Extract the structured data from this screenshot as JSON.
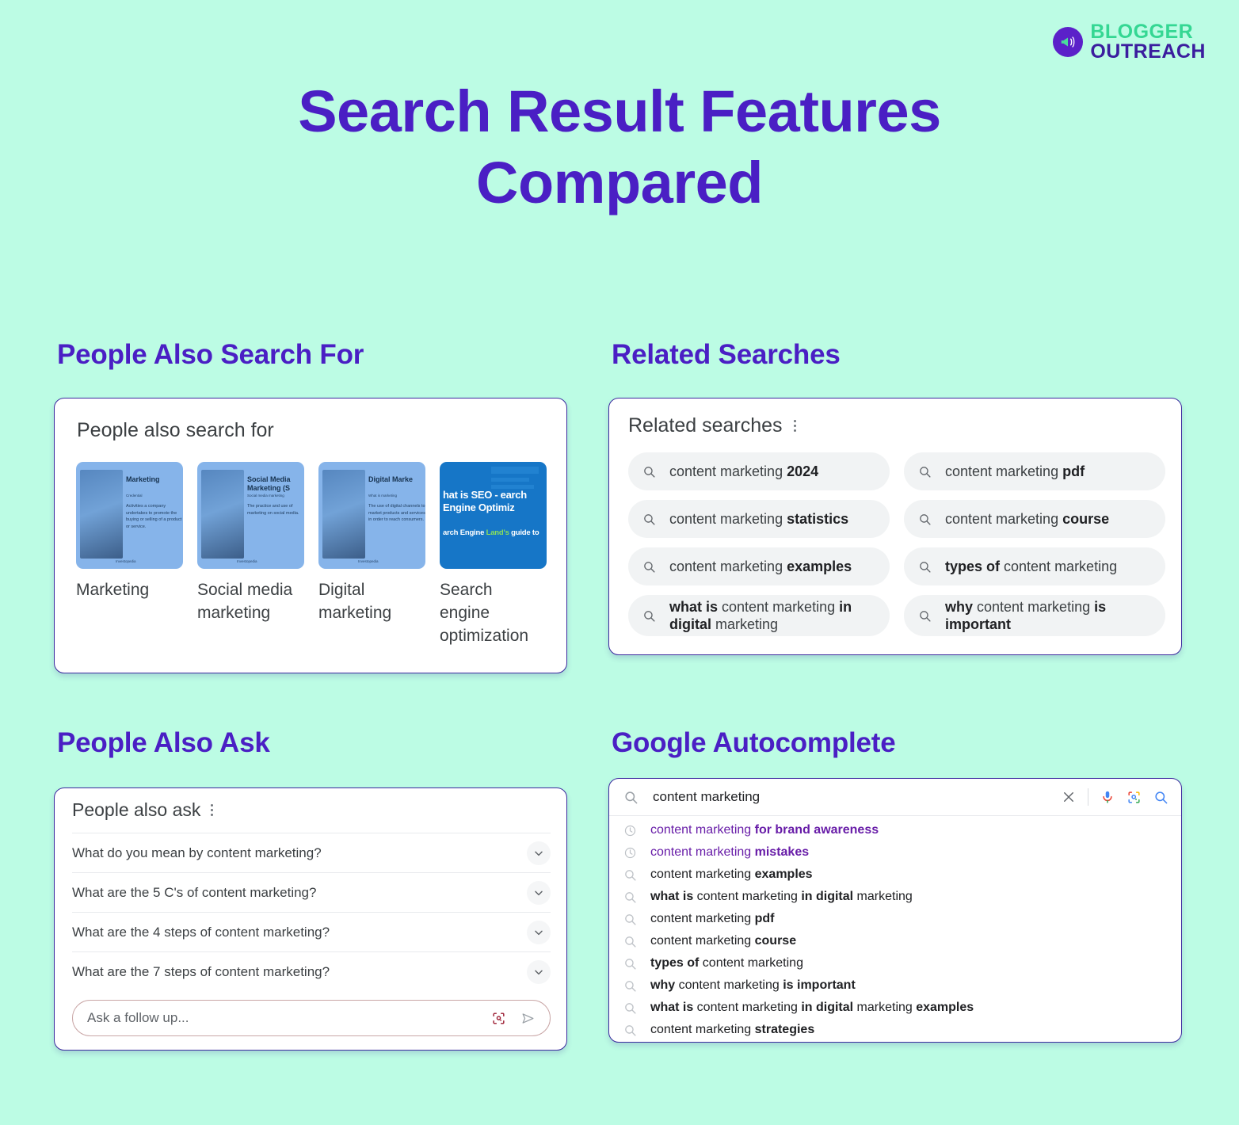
{
  "brand": {
    "name_top": "BLOGGER",
    "name_bottom": "OUTREACH",
    "icon": "megaphone-icon",
    "color_top": "#34D793",
    "color_bottom": "#3B1D9E"
  },
  "page": {
    "title_line1": "Search Result Features",
    "title_line2": "Compared",
    "title_color": "#4A1FC4",
    "background_color": "#BCFCE4"
  },
  "sections": {
    "pasf": {
      "heading": "People Also Search For"
    },
    "related": {
      "heading": "Related Searches"
    },
    "paa": {
      "heading": "People Also Ask"
    },
    "autocomplete": {
      "heading": "Google Autocomplete"
    }
  },
  "pasf_card": {
    "title": "People also search for",
    "items": [
      {
        "label": "Marketing",
        "thumb_style": "light",
        "thumb_heading": "Marketing",
        "thumb_sub": "Credential",
        "thumb_body": "Activities a company undertakes to promote the buying or selling of a product or service.",
        "thumb_foot": "Investopedia"
      },
      {
        "label": "Social media marketing",
        "thumb_style": "light",
        "thumb_heading": "Social Media Marketing (S",
        "thumb_sub": "Social media marketing",
        "thumb_body": "The practice and use of marketing on social media.",
        "thumb_foot": "Investopedia"
      },
      {
        "label": "Digital marketing",
        "thumb_style": "light",
        "thumb_heading": "Digital Marke",
        "thumb_sub": "What is marketing",
        "thumb_body": "The use of digital channels to market products and services in order to reach consumers.",
        "thumb_foot": "Investopedia"
      },
      {
        "label": "Search engine optimization",
        "thumb_style": "dark",
        "seo_line1": "hat is SEO - earch Engine Optimiz",
        "seo_line2_a": "arch Engine ",
        "seo_line2_hl": "Land's",
        "seo_line2_b": " guide to"
      }
    ]
  },
  "related_card": {
    "title": "Related searches",
    "menu_icon": "kebab-menu-icon",
    "pills": [
      {
        "icon": "search-icon",
        "plain1": "content marketing ",
        "bold": "2024",
        "plain2": ""
      },
      {
        "icon": "search-icon",
        "plain1": "content marketing ",
        "bold": "pdf",
        "plain2": ""
      },
      {
        "icon": "search-icon",
        "plain1": "content marketing ",
        "bold": "statistics",
        "plain2": ""
      },
      {
        "icon": "search-icon",
        "plain1": "content marketing ",
        "bold": "course",
        "plain2": ""
      },
      {
        "icon": "search-icon",
        "plain1": "content marketing ",
        "bold": "examples",
        "plain2": ""
      },
      {
        "icon": "search-icon",
        "plain1": "",
        "bold": "types of",
        "plain2": " content marketing"
      },
      {
        "icon": "search-icon",
        "plain1": "",
        "bold": "what is",
        "plain2": " content marketing",
        "bold2": " in digital",
        "plain3": " marketing",
        "tall": true
      },
      {
        "icon": "search-icon",
        "plain1": "",
        "bold": "why",
        "plain2": " content marketing",
        "bold2": " is important",
        "plain3": "",
        "tall": true
      }
    ]
  },
  "paa_card": {
    "title": "People also ask",
    "menu_icon": "kebab-menu-icon",
    "questions": [
      "What do you mean by content marketing?",
      "What are the 5 C's of content marketing?",
      "What are the 4 steps of content marketing?",
      "What are the 7 steps of content marketing?"
    ],
    "expand_icon": "chevron-down-icon",
    "followup_placeholder": "Ask a follow up...",
    "followup_icons": [
      "google-lens-icon",
      "send-icon"
    ]
  },
  "autocomplete_card": {
    "search_query": "content marketing",
    "bar_icons": [
      "search-icon",
      "close-icon",
      "microphone-icon",
      "google-lens-icon",
      "search-submit-icon"
    ],
    "suggestions": [
      {
        "icon": "history-clock-icon",
        "visited": true,
        "plain1": "content marketing ",
        "bold": "for brand awareness",
        "plain2": ""
      },
      {
        "icon": "history-clock-icon",
        "visited": true,
        "plain1": "content marketing ",
        "bold": "mistakes",
        "plain2": ""
      },
      {
        "icon": "search-icon",
        "visited": false,
        "plain1": "content marketing ",
        "bold": "examples",
        "plain2": ""
      },
      {
        "icon": "search-icon",
        "visited": false,
        "plain1": "",
        "bold": "what is",
        "plain2": " content marketing ",
        "bold2": "in digital",
        "plain3": " marketing"
      },
      {
        "icon": "search-icon",
        "visited": false,
        "plain1": "content marketing ",
        "bold": "pdf",
        "plain2": ""
      },
      {
        "icon": "search-icon",
        "visited": false,
        "plain1": "content marketing ",
        "bold": "course",
        "plain2": ""
      },
      {
        "icon": "search-icon",
        "visited": false,
        "plain1": "",
        "bold": "types of",
        "plain2": " content marketing"
      },
      {
        "icon": "search-icon",
        "visited": false,
        "plain1": "",
        "bold": "why",
        "plain2": " content marketing ",
        "bold2": "is important",
        "plain3": ""
      },
      {
        "icon": "search-icon",
        "visited": false,
        "plain1": "",
        "bold": "what is",
        "plain2": " content marketing ",
        "bold2": "in digital",
        "plain3": " marketing ",
        "bold3": "examples"
      },
      {
        "icon": "search-icon",
        "visited": false,
        "plain1": "content marketing ",
        "bold": "strategies",
        "plain2": ""
      }
    ]
  }
}
